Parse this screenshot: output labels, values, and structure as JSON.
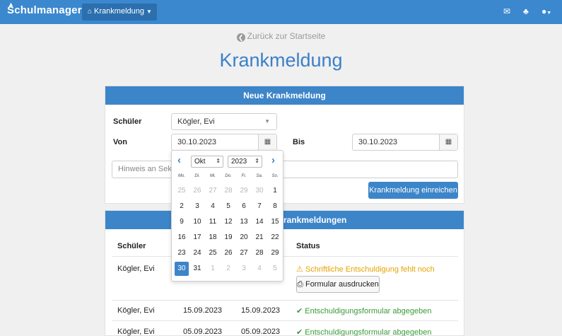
{
  "navbar": {
    "brand": "Schulmanager",
    "menu_label": "Krankmeldung",
    "icons": [
      "mail-icon",
      "bell-icon",
      "user-icon"
    ]
  },
  "back_link": "Zurück zur Startseite",
  "page_title": "Krankmeldung",
  "form": {
    "header": "Neue Krankmeldung",
    "student_label": "Schüler",
    "student_value": "Kögler, Evi",
    "from_label": "Von",
    "from_value": "30.10.2023",
    "to_label": "Bis",
    "to_value": "30.10.2023",
    "note_placeholder": "Hinweis an Sekret",
    "submit_label": "Krankmeldung einreichen"
  },
  "datepicker": {
    "month": "Okt",
    "year": "2023",
    "weekdays": [
      "Mo.",
      "Di.",
      "Mi.",
      "Do.",
      "Fr.",
      "Sa.",
      "So."
    ],
    "weeks": [
      [
        "25",
        "26",
        "27",
        "28",
        "29",
        "30",
        "1"
      ],
      [
        "2",
        "3",
        "4",
        "5",
        "6",
        "7",
        "8"
      ],
      [
        "9",
        "10",
        "11",
        "12",
        "13",
        "14",
        "15"
      ],
      [
        "16",
        "17",
        "18",
        "19",
        "20",
        "21",
        "22"
      ],
      [
        "23",
        "24",
        "25",
        "26",
        "27",
        "28",
        "29"
      ],
      [
        "30",
        "31",
        "1",
        "2",
        "3",
        "4",
        "5"
      ]
    ],
    "selected_day": "30"
  },
  "list": {
    "header_visible": "rankmeldungen",
    "col_student": "Schüler",
    "col_status": "Status",
    "rows": [
      {
        "student": "Kögler, Evi",
        "from": "",
        "to": "",
        "status": "Schriftliche Entschuldigung fehlt noch",
        "status_type": "warning",
        "action": "Formular ausdrucken"
      },
      {
        "student": "Kögler, Evi",
        "from": "15.09.2023",
        "to": "15.09.2023",
        "status": "Entschuldigungsformular abgegeben",
        "status_type": "ok"
      },
      {
        "student": "Kögler, Evi",
        "from": "05.09.2023",
        "to": "05.09.2023",
        "status": "Entschuldigungsformular abgegeben",
        "status_type": "ok"
      }
    ]
  },
  "colors": {
    "primary": "#3b88cf",
    "title": "#3b80c8",
    "warning": "#e6a300",
    "success": "#3a9b3a"
  }
}
